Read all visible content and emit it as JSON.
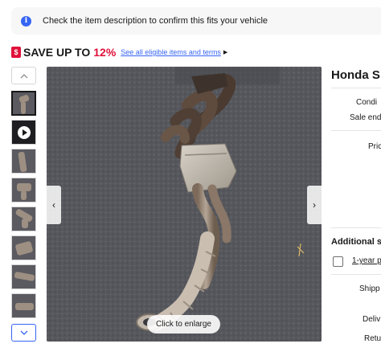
{
  "notice": {
    "icon": "info-icon",
    "text": "Check the item description to confirm this fits your vehicle"
  },
  "promo": {
    "icon": "price-tag-icon",
    "save_label": "SAVE UP TO",
    "save_percent": "12%",
    "link_text": "See all eligible items and terms",
    "accent_color": "#e0103a",
    "link_color": "#3665f3"
  },
  "gallery": {
    "thumbnail_count": 8,
    "selected_index": 0,
    "enlarge_label": "Click to enlarge",
    "prev_icon": "chevron-left-icon",
    "next_icon": "chevron-right-icon",
    "up_icon": "chevron-up-icon",
    "down_icon": "chevron-down-icon"
  },
  "listing": {
    "title": "Honda S",
    "condition_label": "Condi",
    "sale_ends_label": "Sale end",
    "price_label": "Pric",
    "additional_services_heading": "Additional se",
    "protection_plan_link": "1-year p",
    "shipping_label": "Shipp",
    "delivery_label": "Deliv",
    "returns_label": "Retu"
  }
}
